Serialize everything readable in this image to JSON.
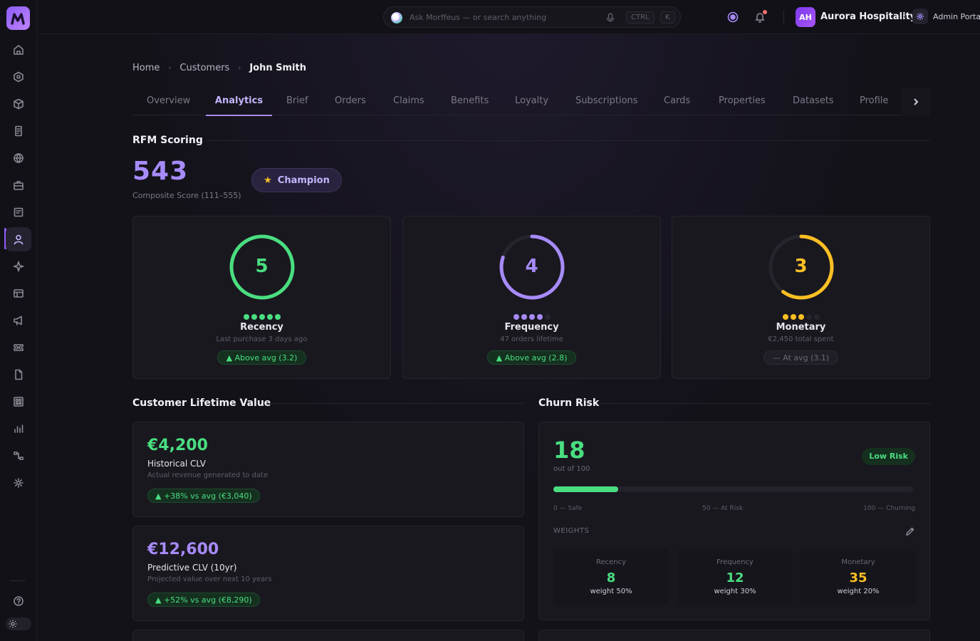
{
  "app": {
    "logo_letter": "M"
  },
  "sidebar": {
    "items": [
      {
        "name": "home-icon"
      },
      {
        "name": "hexagon-icon"
      },
      {
        "name": "box-icon"
      },
      {
        "name": "document-icon"
      },
      {
        "name": "globe-icon"
      },
      {
        "name": "briefcase-icon"
      },
      {
        "name": "form-icon"
      },
      {
        "name": "user-icon",
        "active": true
      },
      {
        "name": "sparkle-icon"
      },
      {
        "name": "table-icon"
      },
      {
        "name": "megaphone-icon"
      },
      {
        "name": "ticket-icon"
      },
      {
        "name": "file-icon"
      },
      {
        "name": "grid-icon"
      },
      {
        "name": "bar-chart-icon"
      },
      {
        "name": "flow-icon"
      },
      {
        "name": "settings-icon"
      }
    ]
  },
  "topbar": {
    "search_placeholder": "Ask Morffeus — or search anything",
    "kbd_ctrl": "CTRL",
    "kbd_k": "K",
    "org_initials": "AH",
    "org_name": "Aurora Hospitality",
    "admin_label": "Admin Portal"
  },
  "breadcrumb": {
    "home": "Home",
    "customers": "Customers",
    "current": "John Smith"
  },
  "tabs": [
    "Overview",
    "Analytics",
    "Brief",
    "Orders",
    "Claims",
    "Benefits",
    "Loyalty",
    "Subscriptions",
    "Cards",
    "Properties",
    "Datasets",
    "Profile"
  ],
  "active_tab": "Analytics",
  "rfm": {
    "section_title": "RFM Scoring",
    "score": "543",
    "score_sub": "Composite Score (111–555)",
    "badge": "Champion",
    "cards": [
      {
        "score": "5",
        "score_value": 5,
        "label": "Recency",
        "desc": "Last purchase 3 days ago",
        "pill": "▲ Above avg (3.2)",
        "pill_type": "green",
        "color": "#4ade80"
      },
      {
        "score": "4",
        "score_value": 4,
        "label": "Frequency",
        "desc": "47 orders lifetime",
        "pill": "▲ Above avg (2.8)",
        "pill_type": "green",
        "color": "#a78bfa"
      },
      {
        "score": "3",
        "score_value": 3,
        "label": "Monetary",
        "desc": "€2,450 total spent",
        "pill": "— At avg (3.1)",
        "pill_type": "gray",
        "color": "#fbbf24"
      }
    ]
  },
  "clv": {
    "section_title": "Customer Lifetime Value",
    "historical": {
      "value": "€4,200",
      "title": "Historical CLV",
      "desc": "Actual revenue generated to date",
      "pill": "▲ +38% vs avg (€3,040)",
      "color": "#4ade80"
    },
    "predictive": {
      "value": "€12,600",
      "title": "Predictive CLV (10yr)",
      "desc": "Projected value over next 10 years",
      "pill": "▲ +52% vs avg (€8,290)",
      "color": "#a78bfa"
    }
  },
  "churn": {
    "section_title": "Churn Risk",
    "score": "18",
    "score_value": 18,
    "score_sub": "out of 100",
    "badge": "Low Risk",
    "scale_low": "0 — Safe",
    "scale_mid": "50 — At Risk",
    "scale_high": "100 — Churning",
    "weights_label": "WEIGHTS",
    "weights": [
      {
        "label": "Recency",
        "value": "8",
        "weight": "weight 50%",
        "color": "#4ade80"
      },
      {
        "label": "Frequency",
        "value": "12",
        "weight": "weight 30%",
        "color": "#4ade80"
      },
      {
        "label": "Monetary",
        "value": "35",
        "weight": "weight 20%",
        "color": "#fbbf24"
      }
    ]
  }
}
